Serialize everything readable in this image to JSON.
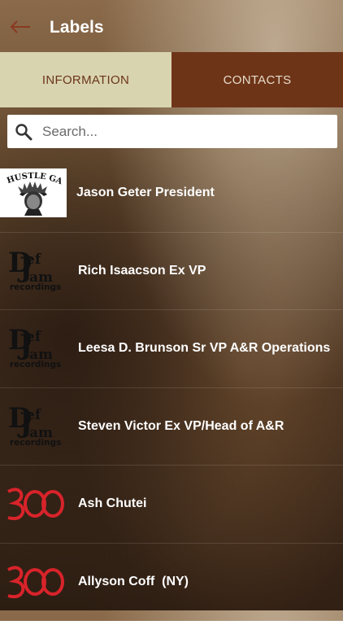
{
  "header": {
    "title": "Labels"
  },
  "tabs": [
    {
      "label": "INFORMATION",
      "selected": true
    },
    {
      "label": "CONTACTS",
      "selected": false
    }
  ],
  "search": {
    "placeholder": "Search..."
  },
  "items": [
    {
      "label": "Jason Geter President",
      "logo": "hustle-gang-logo",
      "logo_text": "HUSTLE GANG"
    },
    {
      "label": "Rich Isaacson Ex VP",
      "logo": "def-jam-logo"
    },
    {
      "label": "Leesa D. Brunson Sr VP A&R Operations",
      "logo": "def-jam-logo"
    },
    {
      "label": "Steven Victor Ex VP/Head of A&R",
      "logo": "def-jam-logo"
    },
    {
      "label": "Ash Chutei",
      "logo": "300-logo"
    },
    {
      "label": "Allyson Coff  (NY)",
      "logo": "300-logo"
    }
  ],
  "colors": {
    "tab_selected_bg": "#d9d4b0",
    "tab_unselected_bg": "#6e3418",
    "back_arrow": "#8a3a22",
    "logo_300_red": "#d8232a"
  }
}
